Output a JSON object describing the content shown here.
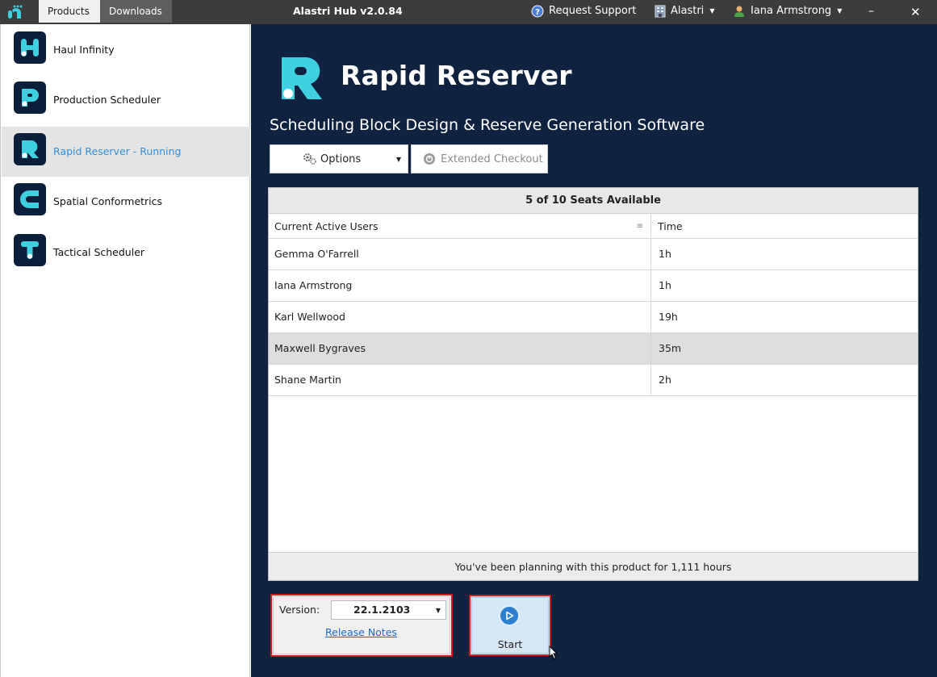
{
  "titlebar": {
    "title": "Alastri Hub v2.0.84",
    "tabs": [
      {
        "label": "Products",
        "active": true
      },
      {
        "label": "Downloads",
        "active": false
      }
    ],
    "support_label": "Request Support",
    "org_label": "Alastri",
    "user_label": "Iana Armstrong",
    "minimize_label": "–",
    "close_label": "✕"
  },
  "sidebar": {
    "items": [
      {
        "label": "Haul Infinity",
        "letter": "H",
        "active": false
      },
      {
        "label": "Production Scheduler",
        "letter": "P",
        "active": false
      },
      {
        "label": "Rapid Reserver - Running",
        "letter": "R",
        "active": true
      },
      {
        "label": "Spatial Conformetrics",
        "letter": "C",
        "active": false
      },
      {
        "label": "Tactical Scheduler",
        "letter": "T",
        "active": false
      }
    ]
  },
  "main": {
    "product_title": "Rapid Reserver",
    "subtitle": "Scheduling Block Design & Reserve Generation Software",
    "options_label": "Options",
    "extended_checkout_label": "Extended Checkout",
    "seats_header": "5 of 10 Seats Available",
    "columns": {
      "users": "Current Active Users",
      "time": "Time"
    },
    "rows": [
      {
        "user": "Gemma O'Farrell",
        "time": "1h"
      },
      {
        "user": "Iana Armstrong",
        "time": "1h"
      },
      {
        "user": "Karl Wellwood",
        "time": "19h"
      },
      {
        "user": "Maxwell Bygraves",
        "time": "35m"
      },
      {
        "user": "Shane Martin",
        "time": "2h"
      }
    ],
    "footer": "You've been planning with this product for 1,111 hours",
    "version_label": "Version:",
    "version_value": "22.1.2103",
    "release_notes": "Release Notes",
    "start_label": "Start"
  },
  "colors": {
    "main_bg": "#0f2340",
    "accent_cyan": "#3fd0e0",
    "active_link": "#2f8fe0",
    "highlight_red": "#d61a1a"
  }
}
